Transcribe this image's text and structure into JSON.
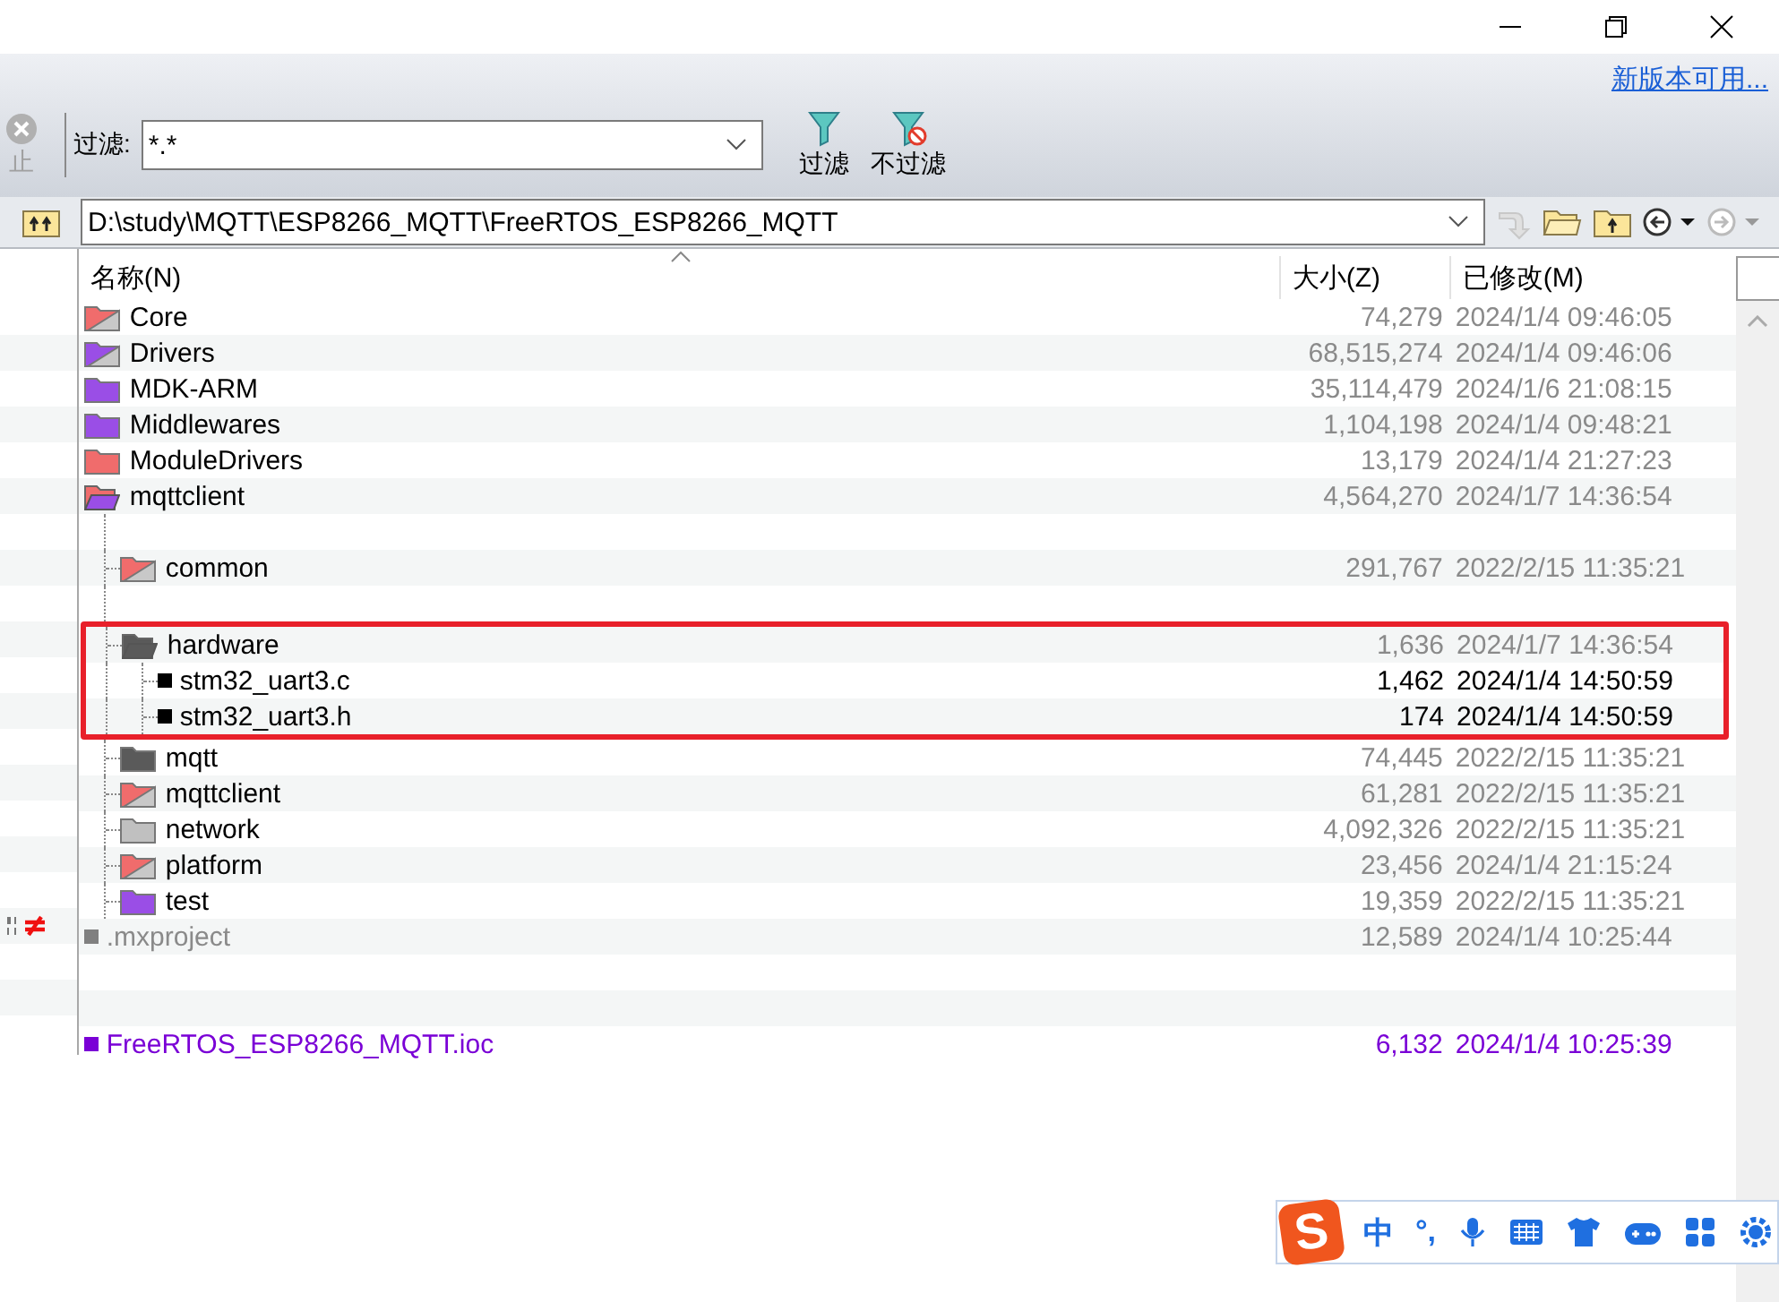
{
  "update_link": "新版本可用...",
  "toolbar": {
    "stop": {
      "label": "止",
      "disabled": true
    },
    "filter_label": "过滤:",
    "filter": {
      "value": "*.*"
    },
    "buttons": [
      {
        "label": "过滤",
        "kind": "filter"
      },
      {
        "label": "不过滤",
        "kind": "unfilter"
      }
    ]
  },
  "path": {
    "value": "D:\\study\\MQTT\\ESP8266_MQTT\\FreeRTOS_ESP8266_MQTT"
  },
  "columns": [
    "名称(N)",
    "大小(Z)",
    "已修改(M)"
  ],
  "files": [
    {
      "kind": "folder",
      "name": "Core",
      "size": "74,279",
      "modified": "2024/1/4 09:46:05",
      "changed": false,
      "orphan": false,
      "color": "#f06c6c",
      "split": true
    },
    {
      "kind": "folder",
      "name": "Drivers",
      "size": "68,515,274",
      "modified": "2024/1/4 09:46:06",
      "changed": false,
      "orphan": false,
      "color": "#9a4ee6",
      "split": true
    },
    {
      "kind": "folder",
      "name": "MDK-ARM",
      "size": "35,114,479",
      "modified": "2024/1/6 21:08:15",
      "changed": false,
      "orphan": false,
      "color": "#9a4ee6",
      "split": false
    },
    {
      "kind": "folder",
      "name": "Middlewares",
      "size": "1,104,198",
      "modified": "2024/1/4 09:48:21",
      "changed": false,
      "orphan": false,
      "color": "#9a4ee6",
      "split": false
    },
    {
      "kind": "folder",
      "name": "ModuleDrivers",
      "size": "13,179",
      "modified": "2024/1/4 21:27:23",
      "changed": false,
      "orphan": false,
      "color": "#f06c6c",
      "split": false
    },
    {
      "kind": "folder-open",
      "name": "mqttclient",
      "size": "4,564,270",
      "modified": "2024/1/7 14:36:54",
      "changed": false,
      "orphan": false,
      "color": "#f06c6c",
      "split": true,
      "children": [
        {
          "kind": "blank"
        },
        {
          "kind": "folder",
          "name": "common",
          "size": "291,767",
          "modified": "2022/2/15 11:35:21",
          "changed": false,
          "orphan": false,
          "color": "#f06c6c",
          "split": true
        },
        {
          "kind": "blank"
        },
        {
          "kind": "folder-open",
          "name": "hardware",
          "size": "1,636",
          "modified": "2024/1/7 14:36:54",
          "changed": false,
          "orphan": false,
          "color": "#5a5a5a",
          "split": false,
          "outlined": true,
          "children": [
            {
              "kind": "file",
              "name": "stm32_uart3.c",
              "size": "1,462",
              "modified": "2024/1/4 14:50:59",
              "changed": true,
              "orphan": false,
              "color": "#000000"
            },
            {
              "kind": "file",
              "name": "stm32_uart3.h",
              "size": "174",
              "modified": "2024/1/4 14:50:59",
              "changed": true,
              "orphan": false,
              "color": "#000000"
            }
          ]
        },
        {
          "kind": "folder",
          "name": "mqtt",
          "size": "74,445",
          "modified": "2022/2/15 11:35:21",
          "changed": false,
          "orphan": false,
          "color": "#5a5a5a",
          "split": false
        },
        {
          "kind": "folder",
          "name": "mqttclient",
          "size": "61,281",
          "modified": "2022/2/15 11:35:21",
          "changed": false,
          "orphan": false,
          "color": "#f06c6c",
          "split": true
        },
        {
          "kind": "folder",
          "name": "network",
          "size": "4,092,326",
          "modified": "2022/2/15 11:35:21",
          "changed": false,
          "orphan": false,
          "color": "#c0c0c0",
          "split": false
        },
        {
          "kind": "folder",
          "name": "platform",
          "size": "23,456",
          "modified": "2024/1/4 21:15:24",
          "changed": false,
          "orphan": false,
          "color": "#f06c6c",
          "split": true
        },
        {
          "kind": "folder",
          "name": "test",
          "size": "19,359",
          "modified": "2022/2/15 11:35:21",
          "changed": false,
          "orphan": false,
          "color": "#9a4ee6",
          "split": false
        }
      ]
    },
    {
      "kind": "file",
      "name": ".mxproject",
      "size": "12,589",
      "modified": "2024/1/4 10:25:44",
      "changed": false,
      "orphan": false,
      "color": "#808080",
      "binary_diff": true
    },
    {
      "kind": "blank"
    },
    {
      "kind": "blank"
    },
    {
      "kind": "file",
      "name": "FreeRTOS_ESP8266_MQTT.ioc",
      "size": "6,132",
      "modified": "2024/1/4 10:25:39",
      "changed": false,
      "orphan": true,
      "color": "#7a00d6"
    }
  ],
  "ime": {
    "logo": "S",
    "mode": "中",
    "punct": "°,"
  }
}
